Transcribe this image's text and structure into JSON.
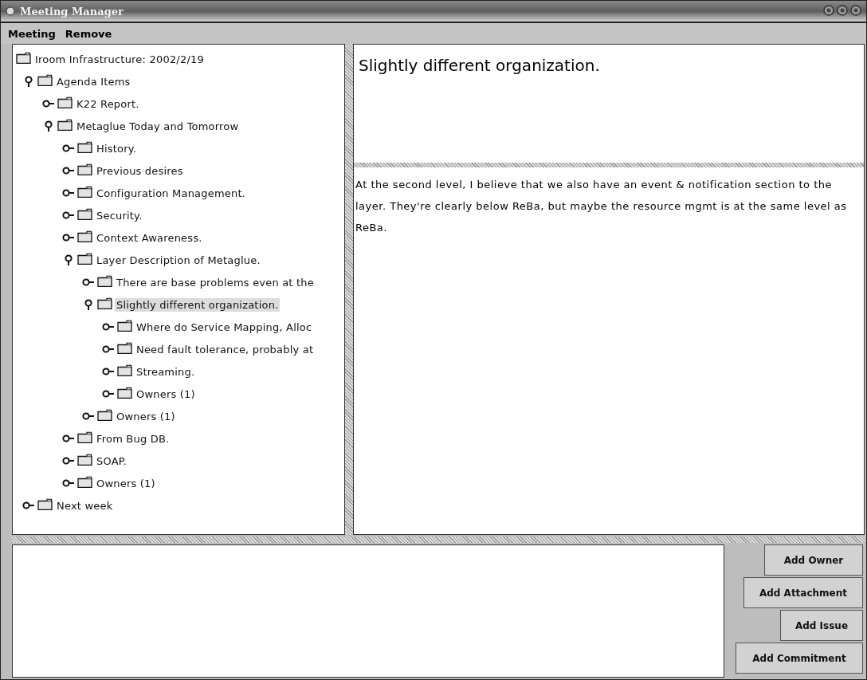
{
  "window": {
    "title": "Meeting Manager"
  },
  "menu": [
    "Meeting",
    "Remove"
  ],
  "tree": {
    "label": "Iroom Infrastructure: 2002/2/19",
    "children": [
      {
        "label": "Agenda Items",
        "expanded": true,
        "selected": false,
        "children": [
          {
            "label": "K22 Report.",
            "expanded": false,
            "selected": false
          },
          {
            "label": "Metaglue Today and Tomorrow",
            "expanded": true,
            "selected": false,
            "children": [
              {
                "label": "History.",
                "expanded": false,
                "selected": false
              },
              {
                "label": "Previous desires",
                "expanded": false,
                "selected": false
              },
              {
                "label": "Configuration Management.",
                "expanded": false,
                "selected": false
              },
              {
                "label": "Security.",
                "expanded": false,
                "selected": false
              },
              {
                "label": "Context Awareness.",
                "expanded": false,
                "selected": false
              },
              {
                "label": "Layer Description of Metaglue.",
                "expanded": true,
                "selected": false,
                "children": [
                  {
                    "label": "There are base problems even at the",
                    "expanded": false,
                    "selected": false
                  },
                  {
                    "label": "Slightly different organization.",
                    "expanded": true,
                    "selected": true,
                    "children": [
                      {
                        "label": "Where do Service Mapping, Alloc",
                        "expanded": false,
                        "selected": false
                      },
                      {
                        "label": "Need fault tolerance, probably at",
                        "expanded": false,
                        "selected": false
                      },
                      {
                        "label": "Streaming.",
                        "expanded": false,
                        "selected": false
                      },
                      {
                        "label": "Owners (1)",
                        "expanded": false,
                        "selected": false
                      }
                    ]
                  },
                  {
                    "label": "Owners (1)",
                    "expanded": false,
                    "selected": false
                  }
                ]
              },
              {
                "label": "From Bug DB.",
                "expanded": false,
                "selected": false
              },
              {
                "label": "SOAP.",
                "expanded": false,
                "selected": false
              },
              {
                "label": "Owners (1)",
                "expanded": false,
                "selected": false
              }
            ]
          }
        ]
      },
      {
        "label": "Next week",
        "expanded": false,
        "selected": false
      }
    ]
  },
  "detail": {
    "title": "Slightly different organization.",
    "body": "At the second level, I believe that we also have an event & notification section to the layer.  They're clearly below ReBa, but maybe the resource mgmt is at the same level as ReBa."
  },
  "buttons": [
    "Add Owner",
    "Add Attachment",
    "Add Issue",
    "Add Commitment"
  ]
}
